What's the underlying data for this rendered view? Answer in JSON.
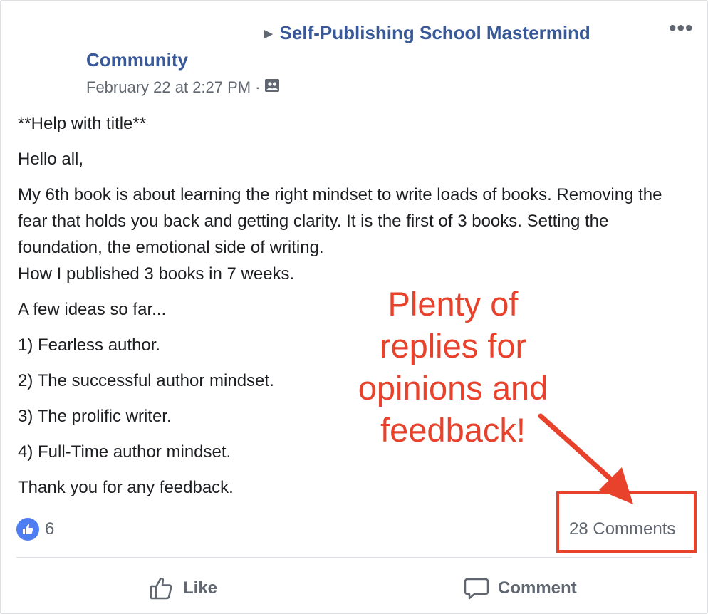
{
  "header": {
    "group_name_line1": "Self-Publishing School Mastermind",
    "group_name_line2": "Community",
    "timestamp": "February 22 at 2:27 PM",
    "separator": "·",
    "audience_icon": "group-audience-icon",
    "more_label": "•••"
  },
  "post": {
    "paragraphs": [
      "**Help with title**",
      "Hello all,",
      "My 6th book is about learning the right mindset to write loads of books. Removing the fear that holds you back and getting clarity. It is the first of 3 books. Setting the foundation, the emotional side of writing.",
      "How I published 3 books in 7 weeks.",
      "A few ideas so far...",
      "1) Fearless author.",
      "2) The successful author mindset.",
      "3) The prolific writer.",
      "4) Full-Time author mindset.",
      "Thank you for any feedback."
    ]
  },
  "annotation": {
    "lines": [
      "Plenty of",
      "replies for",
      "opinions and",
      "feedback!"
    ],
    "color": "#e8412c"
  },
  "stats": {
    "reaction_icon": "thumbs-up-icon",
    "reaction_count": "6",
    "comments_label": "28 Comments"
  },
  "actions": {
    "like_label": "Like",
    "comment_label": "Comment"
  },
  "colors": {
    "link_blue": "#385898",
    "muted_gray": "#606770",
    "like_blue": "#4f7df2",
    "annotation_red": "#e8412c"
  }
}
